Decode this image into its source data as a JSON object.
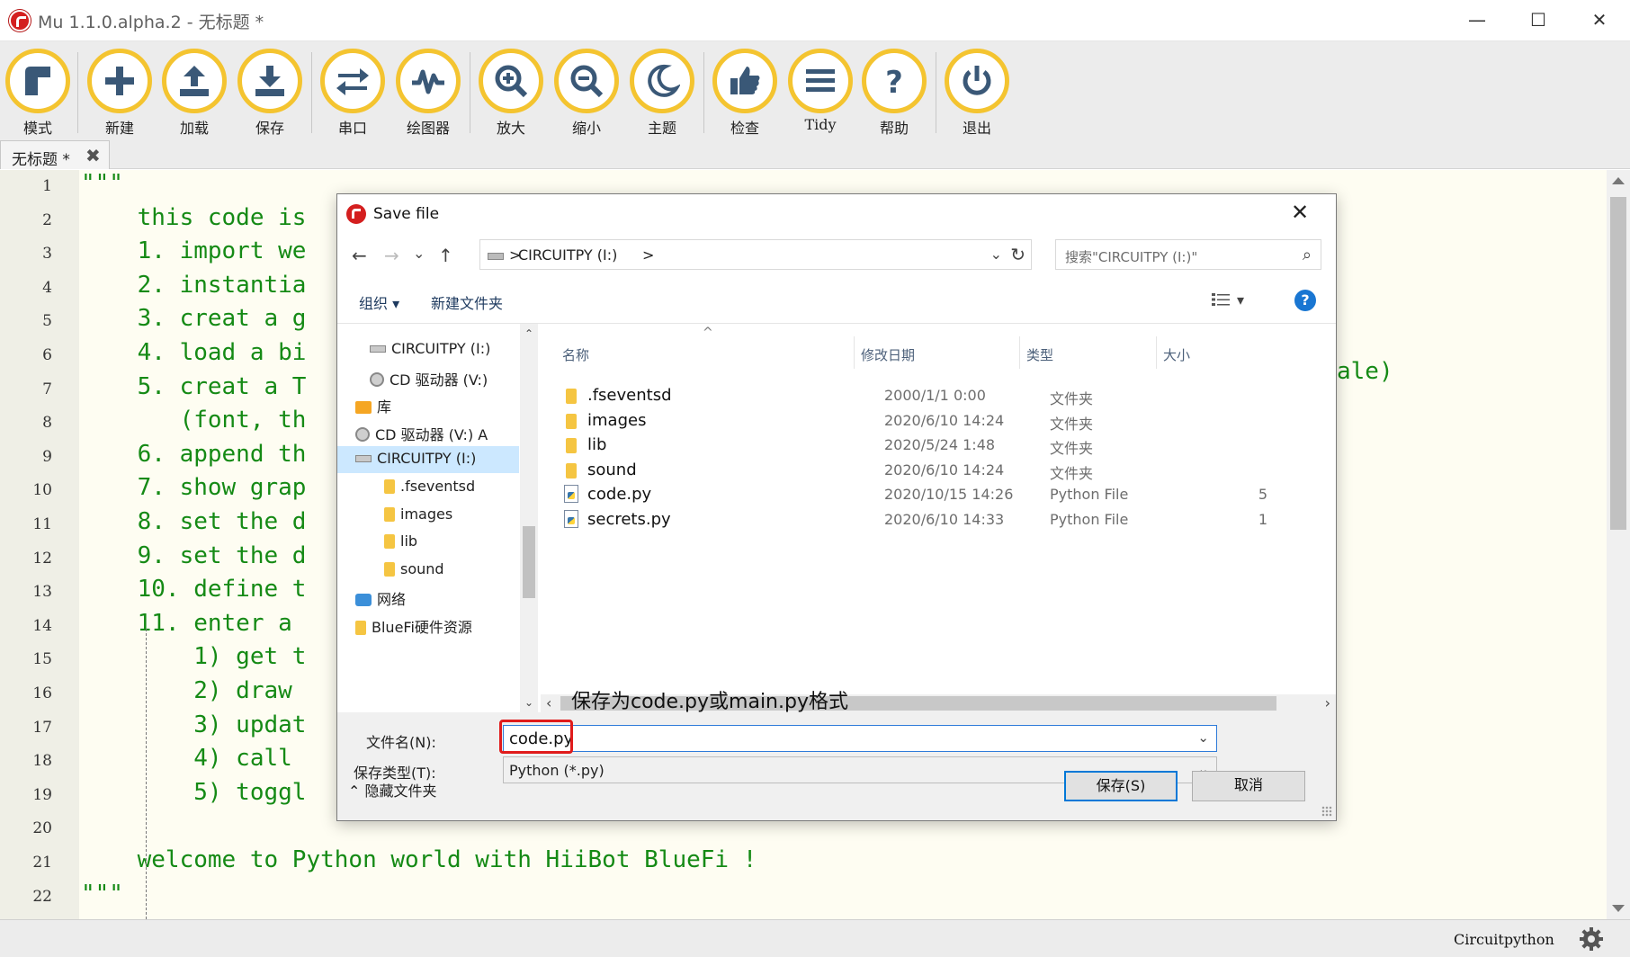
{
  "window": {
    "title": "Mu 1.1.0.alpha.2 - 无标题 *",
    "minimize": "—",
    "maximize": "☐",
    "close": "✕"
  },
  "toolbar": {
    "buttons": [
      {
        "label": "模式",
        "icon": "mode-icon"
      },
      {
        "label": "新建",
        "icon": "new-icon"
      },
      {
        "label": "加载",
        "icon": "load-icon"
      },
      {
        "label": "保存",
        "icon": "save-icon"
      },
      {
        "label": "串口",
        "icon": "serial-icon"
      },
      {
        "label": "绘图器",
        "icon": "plotter-icon"
      },
      {
        "label": "放大",
        "icon": "zoom-in-icon"
      },
      {
        "label": "缩小",
        "icon": "zoom-out-icon"
      },
      {
        "label": "主题",
        "icon": "theme-icon"
      },
      {
        "label": "检查",
        "icon": "check-icon"
      },
      {
        "label": "Tidy",
        "icon": "tidy-icon"
      },
      {
        "label": "帮助",
        "icon": "help-icon"
      },
      {
        "label": "退出",
        "icon": "quit-icon"
      }
    ],
    "accent": "#f4c430"
  },
  "tab": {
    "label": "无标题 *",
    "close": "✖"
  },
  "editor": {
    "line_numbers": [
      "1",
      "2",
      "3",
      "4",
      "5",
      "6",
      "7",
      "8",
      "9",
      "10",
      "11",
      "12",
      "13",
      "14",
      "15",
      "16",
      "17",
      "18",
      "19",
      "20",
      "21",
      "22"
    ],
    "lines": [
      "\"\"\"",
      "    this code is",
      "    1. import we",
      "    2. instantia",
      "    3. creat a g",
      "    4. load a bi",
      "    5. creat a T",
      "       (font, th",
      "    6. append th",
      "    7. show grap",
      "    8. set the d",
      "    9. set the d",
      "    10. define t",
      "    11. enter a ",
      "        1) get t",
      "        2) draw ",
      "        3) updat",
      "        4) call ",
      "        5) toggl",
      "",
      "    welcome to Python world with HiiBot BlueFi !",
      "\"\"\""
    ],
    "line8_tail": "ale)",
    "code_color": "#158a15"
  },
  "status": {
    "mode": "Circuitpython",
    "gear_icon": "gear-icon"
  },
  "dialog": {
    "title": "Save file",
    "close": "✕",
    "nav": {
      "back": "←",
      "forward": "→",
      "recent": "⌄",
      "up": "↑"
    },
    "address": {
      "path": "CIRCUITPY (I:)",
      "sep_before": ">",
      "sep_after": ">",
      "dropdown": "⌄",
      "refresh": "↻"
    },
    "search": {
      "placeholder": "搜索\"CIRCUITPY (I:)\"",
      "icon": "⌕"
    },
    "commands": {
      "organize": "组织 ▾",
      "new_folder": "新建文件夹",
      "view_arrow": "▾",
      "help": "?"
    },
    "tree": [
      {
        "label": "CIRCUITPY (I:)",
        "icon": "drive",
        "indent": 1
      },
      {
        "label": "CD 驱动器 (V:)",
        "icon": "cd",
        "indent": 1
      },
      {
        "label": "库",
        "icon": "library",
        "indent": 0
      },
      {
        "label": "CD 驱动器 (V:) A",
        "icon": "cd",
        "indent": 0
      },
      {
        "label": "CIRCUITPY (I:)",
        "icon": "drive",
        "indent": 0,
        "selected": true
      },
      {
        "label": ".fseventsd",
        "icon": "folder",
        "indent": 2
      },
      {
        "label": "images",
        "icon": "folder",
        "indent": 2
      },
      {
        "label": "lib",
        "icon": "folder",
        "indent": 2
      },
      {
        "label": "sound",
        "icon": "folder",
        "indent": 2
      },
      {
        "label": "网络",
        "icon": "network",
        "indent": 0
      },
      {
        "label": "BlueFi硬件资源",
        "icon": "folder",
        "indent": 0
      }
    ],
    "columns": {
      "name": "名称",
      "date": "修改日期",
      "type": "类型",
      "size": "大小",
      "sort": "^"
    },
    "files": [
      {
        "name": ".fseventsd",
        "date": "2000/1/1 0:00",
        "type": "文件夹",
        "size": "",
        "kind": "folder"
      },
      {
        "name": "images",
        "date": "2020/6/10 14:24",
        "type": "文件夹",
        "size": "",
        "kind": "folder"
      },
      {
        "name": "lib",
        "date": "2020/5/24 1:48",
        "type": "文件夹",
        "size": "",
        "kind": "folder"
      },
      {
        "name": "sound",
        "date": "2020/6/10 14:24",
        "type": "文件夹",
        "size": "",
        "kind": "folder"
      },
      {
        "name": "code.py",
        "date": "2020/10/15 14:26",
        "type": "Python File",
        "size": "5",
        "kind": "py"
      },
      {
        "name": "secrets.py",
        "date": "2020/6/10 14:33",
        "type": "Python File",
        "size": "1",
        "kind": "py"
      }
    ],
    "annotation": "保存为code.py或main.py格式",
    "filename_label": "文件名(N):",
    "filename_value": "code.py",
    "filetype_label": "保存类型(T):",
    "filetype_value": "Python (*.py)",
    "hide_folders": "⌃ 隐藏文件夹",
    "save_button": "保存(S)",
    "cancel_button": "取消",
    "highlight_color": "#e01b1b"
  }
}
